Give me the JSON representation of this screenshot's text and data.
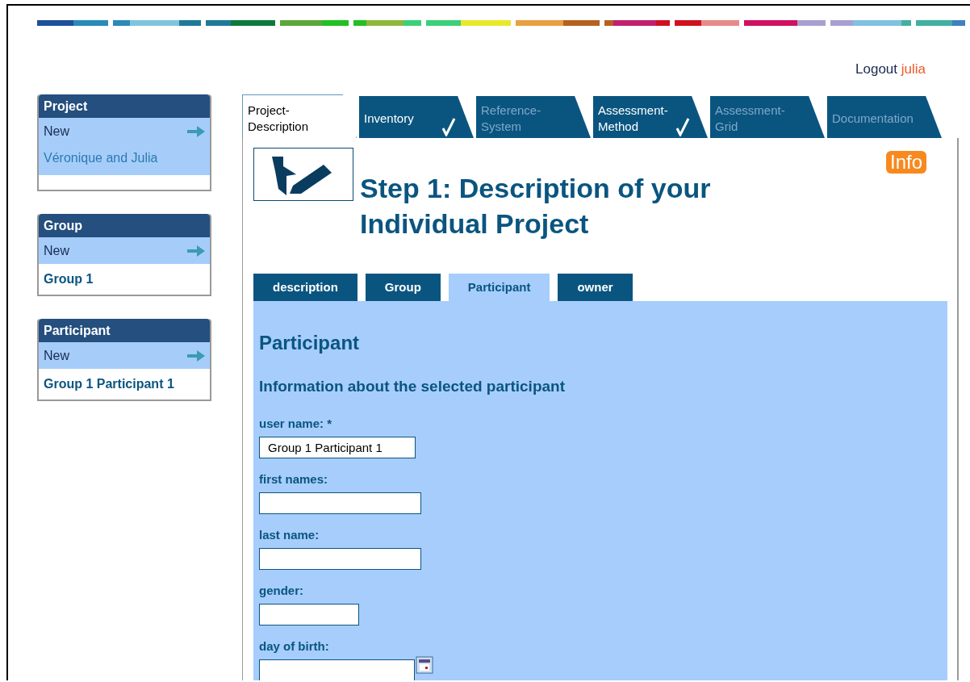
{
  "header": {
    "logout": "Logout",
    "user": "julia"
  },
  "sidebar": [
    {
      "title": "Project",
      "new_label": "New",
      "items": [
        {
          "label": "Véronique and Julia",
          "selected": false
        }
      ]
    },
    {
      "title": "Group",
      "new_label": "New",
      "items": [
        {
          "label": "Group 1",
          "selected": true
        }
      ]
    },
    {
      "title": "Participant",
      "new_label": "New",
      "items": [
        {
          "label": "Group 1 Participant 1",
          "selected": true
        }
      ]
    }
  ],
  "steps": [
    {
      "label": "Project-\nDescription",
      "selected": true,
      "done": false,
      "disabled": false
    },
    {
      "label": "Inventory",
      "selected": false,
      "done": true,
      "disabled": false
    },
    {
      "label": "Reference-\nSystem",
      "selected": false,
      "done": false,
      "disabled": true
    },
    {
      "label": "Assessment-\nMethod",
      "selected": false,
      "done": true,
      "disabled": false
    },
    {
      "label": "Assessment-\nGrid",
      "selected": false,
      "done": false,
      "disabled": true
    },
    {
      "label": "Documentation",
      "selected": false,
      "done": false,
      "disabled": true
    }
  ],
  "info_button": "Info",
  "title": "Step 1: Description of your Individual Project",
  "subtabs": [
    {
      "label": "description",
      "selected": false
    },
    {
      "label": "Group",
      "selected": false
    },
    {
      "label": "Participant",
      "selected": true
    },
    {
      "label": "owner",
      "selected": false
    }
  ],
  "panel": {
    "heading": "Participant",
    "subheading": "Information about the selected participant",
    "fields": [
      {
        "kind": "text",
        "label": "user name: *",
        "value": "Group 1 Participant 1"
      },
      {
        "kind": "wide",
        "label": "first names:"
      },
      {
        "kind": "wide",
        "label": "last name:"
      },
      {
        "kind": "short",
        "label": "gender:"
      },
      {
        "kind": "date",
        "label": "day of birth:"
      }
    ]
  }
}
